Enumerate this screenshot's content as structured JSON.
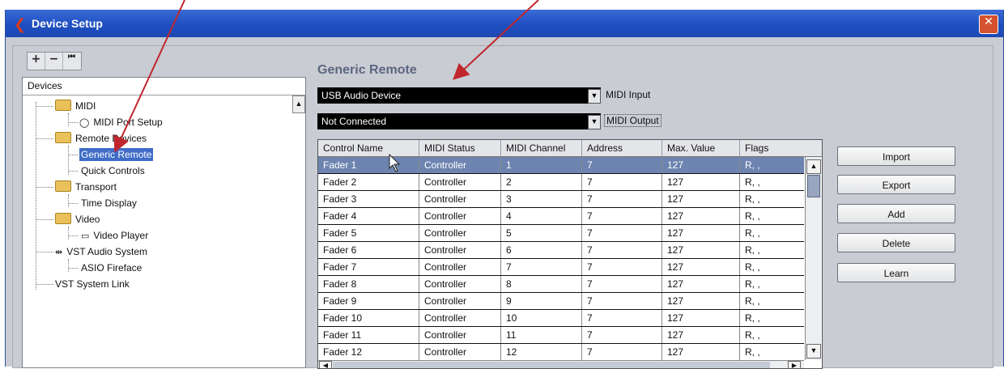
{
  "window": {
    "title": "Device Setup",
    "close_glyph": "✕"
  },
  "toolbar": {
    "add": "+",
    "remove": "−",
    "reset": "⏮"
  },
  "tree": {
    "header": "Devices",
    "items": [
      {
        "label": "MIDI",
        "icon": "folder-icon"
      },
      {
        "label": "MIDI Port Setup",
        "icon": "circle-icon"
      },
      {
        "label": "Remote Devices",
        "icon": "folder-icon"
      },
      {
        "label": "Generic Remote",
        "selected": true
      },
      {
        "label": "Quick Controls"
      },
      {
        "label": "Transport",
        "icon": "folder-icon"
      },
      {
        "label": "Time Display"
      },
      {
        "label": "Video",
        "icon": "folder-icon"
      },
      {
        "label": "Video Player",
        "icon": "video-icon"
      },
      {
        "label": "VST Audio System",
        "icon": "audio-icon"
      },
      {
        "label": "ASIO Fireface"
      },
      {
        "label": "VST System Link"
      }
    ]
  },
  "panel": {
    "title": "Generic Remote",
    "midi_input": {
      "value": "USB Audio Device",
      "label": "MIDI Input"
    },
    "midi_output": {
      "value": "Not Connected",
      "label": "MIDI Output"
    }
  },
  "table": {
    "columns": [
      "Control Name",
      "MIDI Status",
      "MIDI Channel",
      "Address",
      "Max. Value",
      "Flags"
    ],
    "rows": [
      [
        "Fader 1",
        "Controller",
        "1",
        "7",
        "127",
        "R, ,"
      ],
      [
        "Fader 2",
        "Controller",
        "2",
        "7",
        "127",
        "R, ,"
      ],
      [
        "Fader 3",
        "Controller",
        "3",
        "7",
        "127",
        "R, ,"
      ],
      [
        "Fader 4",
        "Controller",
        "4",
        "7",
        "127",
        "R, ,"
      ],
      [
        "Fader 5",
        "Controller",
        "5",
        "7",
        "127",
        "R, ,"
      ],
      [
        "Fader 6",
        "Controller",
        "6",
        "7",
        "127",
        "R, ,"
      ],
      [
        "Fader 7",
        "Controller",
        "7",
        "7",
        "127",
        "R, ,"
      ],
      [
        "Fader 8",
        "Controller",
        "8",
        "7",
        "127",
        "R, ,"
      ],
      [
        "Fader 9",
        "Controller",
        "9",
        "7",
        "127",
        "R, ,"
      ],
      [
        "Fader 10",
        "Controller",
        "10",
        "7",
        "127",
        "R, ,"
      ],
      [
        "Fader 11",
        "Controller",
        "11",
        "7",
        "127",
        "R, ,"
      ],
      [
        "Fader 12",
        "Controller",
        "12",
        "7",
        "127",
        "R, ,"
      ]
    ],
    "selected_row": 0
  },
  "buttons": {
    "import": "Import",
    "export": "Export",
    "add": "Add",
    "delete": "Delete",
    "learn": "Learn"
  },
  "colors": {
    "titlebar": "#1f4fc1",
    "selection": "#3f6cc7",
    "selected_row": "#6d84b0",
    "annotation_arrow": "#c0262d"
  }
}
